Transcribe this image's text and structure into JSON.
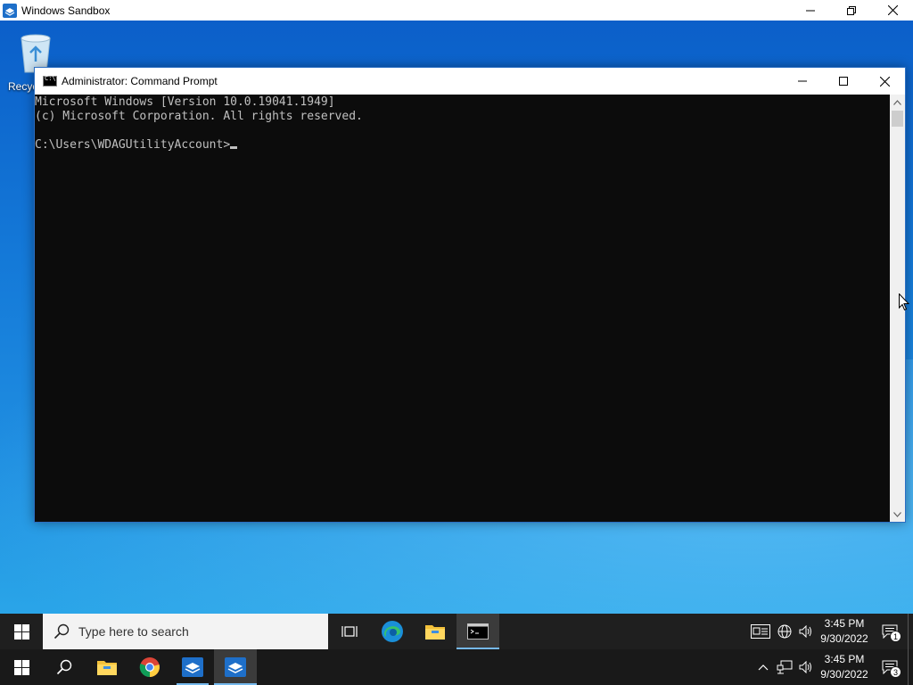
{
  "host_window": {
    "title": "Windows Sandbox",
    "controls": [
      "minimize",
      "maximize",
      "close"
    ]
  },
  "desktop": {
    "recycle_bin_label": "Recycle Bin"
  },
  "cmd_window": {
    "title": "Administrator: Command Prompt",
    "lines": [
      "Microsoft Windows [Version 10.0.19041.1949]",
      "(c) Microsoft Corporation. All rights reserved.",
      "",
      "C:\\Users\\WDAGUtilityAccount>"
    ]
  },
  "taskbar_inner": {
    "search_placeholder": "Type here to search",
    "apps": [
      "task-view-icon",
      "edge-icon",
      "file-explorer-icon",
      "command-prompt-icon"
    ],
    "clock_time": "3:45 PM",
    "clock_date": "9/30/2022",
    "notification_count": "1"
  },
  "taskbar_host": {
    "apps": [
      "search-icon",
      "file-explorer-icon",
      "chrome-icon",
      "sandbox-icon",
      "sandbox-icon"
    ],
    "clock_time": "3:45 PM",
    "clock_date": "9/30/2022",
    "notification_count": "3"
  },
  "colors": {
    "console_bg": "#0c0c0c",
    "console_fg": "#c0c0c0",
    "taskbar_bg": "#1b1b1b",
    "accent": "#76b9ed"
  }
}
